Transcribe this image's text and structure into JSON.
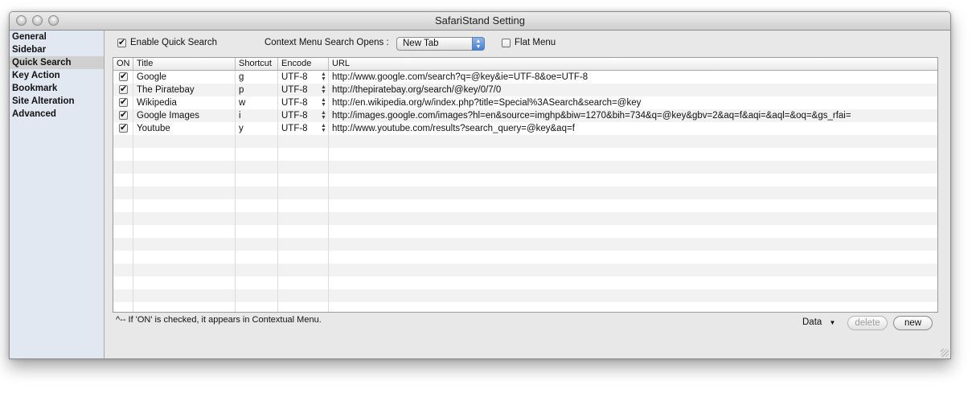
{
  "window": {
    "title": "SafariStand Setting"
  },
  "sidebar": {
    "items": [
      {
        "label": "General"
      },
      {
        "label": "Sidebar"
      },
      {
        "label": "Quick Search",
        "selected": true
      },
      {
        "label": "Key Action"
      },
      {
        "label": "Bookmark"
      },
      {
        "label": "Site Alteration"
      },
      {
        "label": "Advanced"
      }
    ]
  },
  "options": {
    "enable_quick_search": {
      "label": "Enable Quick Search",
      "checked": true
    },
    "context_menu_label": "Context Menu Search Opens :",
    "context_menu_value": "New Tab",
    "flat_menu": {
      "label": "Flat Menu",
      "checked": false
    }
  },
  "table": {
    "columns": [
      "ON",
      "Title",
      "Shortcut",
      "Encode",
      "URL"
    ],
    "rows": [
      {
        "on": true,
        "title": "Google",
        "shortcut": "g",
        "encode": "UTF-8",
        "url": "http://www.google.com/search?q=@key&ie=UTF-8&oe=UTF-8"
      },
      {
        "on": true,
        "title": "The Piratebay",
        "shortcut": "p",
        "encode": "UTF-8",
        "url": "http://thepiratebay.org/search/@key/0/7/0"
      },
      {
        "on": true,
        "title": "Wikipedia",
        "shortcut": "w",
        "encode": "UTF-8",
        "url": "http://en.wikipedia.org/w/index.php?title=Special%3ASearch&search=@key"
      },
      {
        "on": true,
        "title": "Google Images",
        "shortcut": "i",
        "encode": "UTF-8",
        "url": "http://images.google.com/images?hl=en&source=imghp&biw=1270&bih=734&q=@key&gbv=2&aq=f&aqi=&aql=&oq=&gs_rfai="
      },
      {
        "on": true,
        "title": "Youtube",
        "shortcut": "y",
        "encode": "UTF-8",
        "url": "http://www.youtube.com/results?search_query=@key&aq=f"
      }
    ]
  },
  "footer": {
    "note": "^-- If 'ON' is checked, it appears in Contextual Menu.",
    "data_menu_label": "Data",
    "delete_label": "delete",
    "new_label": "new"
  },
  "colors": {
    "selection_gray": "#d0d0d0",
    "sidebar_bg": "#e2e8f1",
    "stepper_blue": "#3f7fd8"
  }
}
